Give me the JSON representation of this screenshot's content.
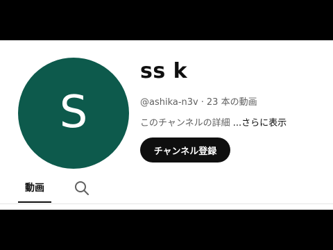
{
  "channel": {
    "avatar_letter": "S",
    "avatar_color": "#0d5a4c",
    "name": "ss k",
    "handle": "@ashika-n3v",
    "separator": "·",
    "video_count": "23 本の動画",
    "description": "このチャンネルの詳細",
    "more_label": "...さらに表示",
    "subscribe_label": "チャンネル登録"
  },
  "tabs": [
    {
      "label": "動画",
      "selected": true
    }
  ],
  "icons": {
    "search": "search-icon"
  }
}
